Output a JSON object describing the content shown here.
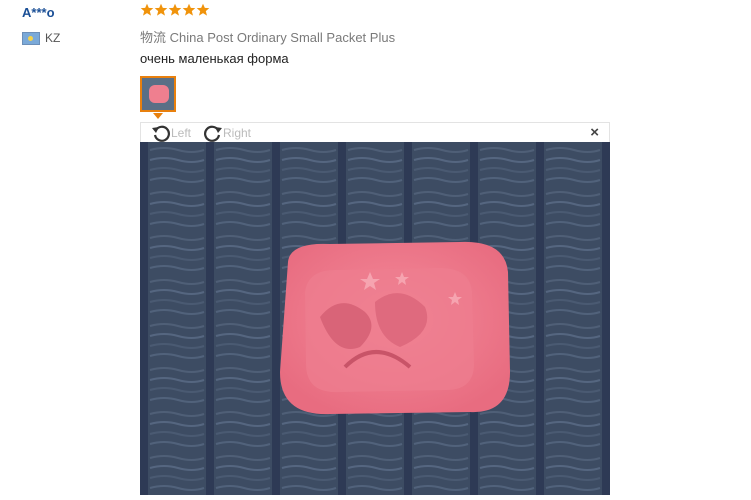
{
  "reviewer": {
    "name": "A***o",
    "country": "KZ",
    "flag_color": "#7aa9d8"
  },
  "rating": {
    "stars": 5,
    "max": 5,
    "color": "#f0930b"
  },
  "shipping": {
    "label": "物流",
    "method": "China Post Ordinary Small Packet Plus"
  },
  "review_text": "очень маленькая форма",
  "viewer": {
    "rotate_left_label": "Left",
    "rotate_right_label": "Right",
    "close_icon": "×"
  },
  "colors": {
    "accent": "#e8800e",
    "link": "#1a4f96",
    "mold_pink": "#ef7f8f",
    "fabric": "#3a4960"
  }
}
